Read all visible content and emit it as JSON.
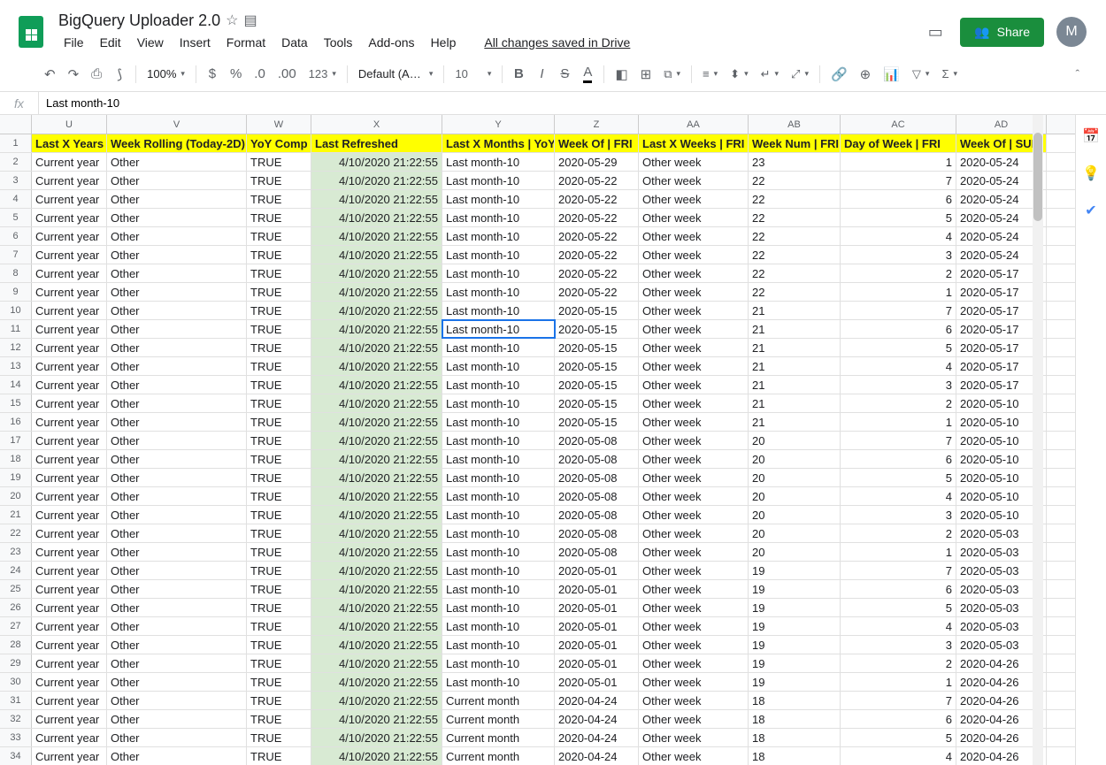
{
  "header": {
    "title": "BigQuery Uploader 2.0",
    "saved_text": "All changes saved in Drive",
    "share_label": "Share",
    "avatar_letter": "M"
  },
  "menubar": [
    "File",
    "Edit",
    "View",
    "Insert",
    "Format",
    "Data",
    "Tools",
    "Add-ons",
    "Help"
  ],
  "toolbar": {
    "zoom": "100%",
    "font": "Default (Ari...",
    "fontsize": "10"
  },
  "formula": {
    "fx": "fx",
    "value": "Last month-10"
  },
  "columns": [
    {
      "letter": "U",
      "label": "Last X Years",
      "cls": "c-u"
    },
    {
      "letter": "V",
      "label": "Week Rolling (Today-2D)",
      "cls": "c-v"
    },
    {
      "letter": "W",
      "label": "YoY Comp",
      "cls": "c-w"
    },
    {
      "letter": "X",
      "label": "Last Refreshed",
      "cls": "c-x"
    },
    {
      "letter": "Y",
      "label": "Last X Months | YoY",
      "cls": "c-y"
    },
    {
      "letter": "Z",
      "label": "Week Of | FRI",
      "cls": "c-z"
    },
    {
      "letter": "AA",
      "label": "Last X Weeks | FRI",
      "cls": "c-aa"
    },
    {
      "letter": "AB",
      "label": "Week Num | FRI",
      "cls": "c-ab"
    },
    {
      "letter": "AC",
      "label": "Day of Week | FRI",
      "cls": "c-ac"
    },
    {
      "letter": "AD",
      "label": "Week Of | SUN",
      "cls": "c-ad"
    }
  ],
  "selected": {
    "row": 11,
    "col": 4
  },
  "rows": [
    {
      "n": 2,
      "u": "Current year",
      "v": "Other",
      "w": "TRUE",
      "x": "4/10/2020 21:22:55",
      "y": "Last month-10",
      "z": "2020-05-29",
      "aa": "Other week",
      "ab": "23",
      "ac": "1",
      "ad": "2020-05-24"
    },
    {
      "n": 3,
      "u": "Current year",
      "v": "Other",
      "w": "TRUE",
      "x": "4/10/2020 21:22:55",
      "y": "Last month-10",
      "z": "2020-05-22",
      "aa": "Other week",
      "ab": "22",
      "ac": "7",
      "ad": "2020-05-24"
    },
    {
      "n": 4,
      "u": "Current year",
      "v": "Other",
      "w": "TRUE",
      "x": "4/10/2020 21:22:55",
      "y": "Last month-10",
      "z": "2020-05-22",
      "aa": "Other week",
      "ab": "22",
      "ac": "6",
      "ad": "2020-05-24"
    },
    {
      "n": 5,
      "u": "Current year",
      "v": "Other",
      "w": "TRUE",
      "x": "4/10/2020 21:22:55",
      "y": "Last month-10",
      "z": "2020-05-22",
      "aa": "Other week",
      "ab": "22",
      "ac": "5",
      "ad": "2020-05-24"
    },
    {
      "n": 6,
      "u": "Current year",
      "v": "Other",
      "w": "TRUE",
      "x": "4/10/2020 21:22:55",
      "y": "Last month-10",
      "z": "2020-05-22",
      "aa": "Other week",
      "ab": "22",
      "ac": "4",
      "ad": "2020-05-24"
    },
    {
      "n": 7,
      "u": "Current year",
      "v": "Other",
      "w": "TRUE",
      "x": "4/10/2020 21:22:55",
      "y": "Last month-10",
      "z": "2020-05-22",
      "aa": "Other week",
      "ab": "22",
      "ac": "3",
      "ad": "2020-05-24"
    },
    {
      "n": 8,
      "u": "Current year",
      "v": "Other",
      "w": "TRUE",
      "x": "4/10/2020 21:22:55",
      "y": "Last month-10",
      "z": "2020-05-22",
      "aa": "Other week",
      "ab": "22",
      "ac": "2",
      "ad": "2020-05-17"
    },
    {
      "n": 9,
      "u": "Current year",
      "v": "Other",
      "w": "TRUE",
      "x": "4/10/2020 21:22:55",
      "y": "Last month-10",
      "z": "2020-05-22",
      "aa": "Other week",
      "ab": "22",
      "ac": "1",
      "ad": "2020-05-17"
    },
    {
      "n": 10,
      "u": "Current year",
      "v": "Other",
      "w": "TRUE",
      "x": "4/10/2020 21:22:55",
      "y": "Last month-10",
      "z": "2020-05-15",
      "aa": "Other week",
      "ab": "21",
      "ac": "7",
      "ad": "2020-05-17"
    },
    {
      "n": 11,
      "u": "Current year",
      "v": "Other",
      "w": "TRUE",
      "x": "4/10/2020 21:22:55",
      "y": "Last month-10",
      "z": "2020-05-15",
      "aa": "Other week",
      "ab": "21",
      "ac": "6",
      "ad": "2020-05-17"
    },
    {
      "n": 12,
      "u": "Current year",
      "v": "Other",
      "w": "TRUE",
      "x": "4/10/2020 21:22:55",
      "y": "Last month-10",
      "z": "2020-05-15",
      "aa": "Other week",
      "ab": "21",
      "ac": "5",
      "ad": "2020-05-17"
    },
    {
      "n": 13,
      "u": "Current year",
      "v": "Other",
      "w": "TRUE",
      "x": "4/10/2020 21:22:55",
      "y": "Last month-10",
      "z": "2020-05-15",
      "aa": "Other week",
      "ab": "21",
      "ac": "4",
      "ad": "2020-05-17"
    },
    {
      "n": 14,
      "u": "Current year",
      "v": "Other",
      "w": "TRUE",
      "x": "4/10/2020 21:22:55",
      "y": "Last month-10",
      "z": "2020-05-15",
      "aa": "Other week",
      "ab": "21",
      "ac": "3",
      "ad": "2020-05-17"
    },
    {
      "n": 15,
      "u": "Current year",
      "v": "Other",
      "w": "TRUE",
      "x": "4/10/2020 21:22:55",
      "y": "Last month-10",
      "z": "2020-05-15",
      "aa": "Other week",
      "ab": "21",
      "ac": "2",
      "ad": "2020-05-10"
    },
    {
      "n": 16,
      "u": "Current year",
      "v": "Other",
      "w": "TRUE",
      "x": "4/10/2020 21:22:55",
      "y": "Last month-10",
      "z": "2020-05-15",
      "aa": "Other week",
      "ab": "21",
      "ac": "1",
      "ad": "2020-05-10"
    },
    {
      "n": 17,
      "u": "Current year",
      "v": "Other",
      "w": "TRUE",
      "x": "4/10/2020 21:22:55",
      "y": "Last month-10",
      "z": "2020-05-08",
      "aa": "Other week",
      "ab": "20",
      "ac": "7",
      "ad": "2020-05-10"
    },
    {
      "n": 18,
      "u": "Current year",
      "v": "Other",
      "w": "TRUE",
      "x": "4/10/2020 21:22:55",
      "y": "Last month-10",
      "z": "2020-05-08",
      "aa": "Other week",
      "ab": "20",
      "ac": "6",
      "ad": "2020-05-10"
    },
    {
      "n": 19,
      "u": "Current year",
      "v": "Other",
      "w": "TRUE",
      "x": "4/10/2020 21:22:55",
      "y": "Last month-10",
      "z": "2020-05-08",
      "aa": "Other week",
      "ab": "20",
      "ac": "5",
      "ad": "2020-05-10"
    },
    {
      "n": 20,
      "u": "Current year",
      "v": "Other",
      "w": "TRUE",
      "x": "4/10/2020 21:22:55",
      "y": "Last month-10",
      "z": "2020-05-08",
      "aa": "Other week",
      "ab": "20",
      "ac": "4",
      "ad": "2020-05-10"
    },
    {
      "n": 21,
      "u": "Current year",
      "v": "Other",
      "w": "TRUE",
      "x": "4/10/2020 21:22:55",
      "y": "Last month-10",
      "z": "2020-05-08",
      "aa": "Other week",
      "ab": "20",
      "ac": "3",
      "ad": "2020-05-10"
    },
    {
      "n": 22,
      "u": "Current year",
      "v": "Other",
      "w": "TRUE",
      "x": "4/10/2020 21:22:55",
      "y": "Last month-10",
      "z": "2020-05-08",
      "aa": "Other week",
      "ab": "20",
      "ac": "2",
      "ad": "2020-05-03"
    },
    {
      "n": 23,
      "u": "Current year",
      "v": "Other",
      "w": "TRUE",
      "x": "4/10/2020 21:22:55",
      "y": "Last month-10",
      "z": "2020-05-08",
      "aa": "Other week",
      "ab": "20",
      "ac": "1",
      "ad": "2020-05-03"
    },
    {
      "n": 24,
      "u": "Current year",
      "v": "Other",
      "w": "TRUE",
      "x": "4/10/2020 21:22:55",
      "y": "Last month-10",
      "z": "2020-05-01",
      "aa": "Other week",
      "ab": "19",
      "ac": "7",
      "ad": "2020-05-03"
    },
    {
      "n": 25,
      "u": "Current year",
      "v": "Other",
      "w": "TRUE",
      "x": "4/10/2020 21:22:55",
      "y": "Last month-10",
      "z": "2020-05-01",
      "aa": "Other week",
      "ab": "19",
      "ac": "6",
      "ad": "2020-05-03"
    },
    {
      "n": 26,
      "u": "Current year",
      "v": "Other",
      "w": "TRUE",
      "x": "4/10/2020 21:22:55",
      "y": "Last month-10",
      "z": "2020-05-01",
      "aa": "Other week",
      "ab": "19",
      "ac": "5",
      "ad": "2020-05-03"
    },
    {
      "n": 27,
      "u": "Current year",
      "v": "Other",
      "w": "TRUE",
      "x": "4/10/2020 21:22:55",
      "y": "Last month-10",
      "z": "2020-05-01",
      "aa": "Other week",
      "ab": "19",
      "ac": "4",
      "ad": "2020-05-03"
    },
    {
      "n": 28,
      "u": "Current year",
      "v": "Other",
      "w": "TRUE",
      "x": "4/10/2020 21:22:55",
      "y": "Last month-10",
      "z": "2020-05-01",
      "aa": "Other week",
      "ab": "19",
      "ac": "3",
      "ad": "2020-05-03"
    },
    {
      "n": 29,
      "u": "Current year",
      "v": "Other",
      "w": "TRUE",
      "x": "4/10/2020 21:22:55",
      "y": "Last month-10",
      "z": "2020-05-01",
      "aa": "Other week",
      "ab": "19",
      "ac": "2",
      "ad": "2020-04-26"
    },
    {
      "n": 30,
      "u": "Current year",
      "v": "Other",
      "w": "TRUE",
      "x": "4/10/2020 21:22:55",
      "y": "Last month-10",
      "z": "2020-05-01",
      "aa": "Other week",
      "ab": "19",
      "ac": "1",
      "ad": "2020-04-26"
    },
    {
      "n": 31,
      "u": "Current year",
      "v": "Other",
      "w": "TRUE",
      "x": "4/10/2020 21:22:55",
      "y": "Current month",
      "z": "2020-04-24",
      "aa": "Other week",
      "ab": "18",
      "ac": "7",
      "ad": "2020-04-26"
    },
    {
      "n": 32,
      "u": "Current year",
      "v": "Other",
      "w": "TRUE",
      "x": "4/10/2020 21:22:55",
      "y": "Current month",
      "z": "2020-04-24",
      "aa": "Other week",
      "ab": "18",
      "ac": "6",
      "ad": "2020-04-26"
    },
    {
      "n": 33,
      "u": "Current year",
      "v": "Other",
      "w": "TRUE",
      "x": "4/10/2020 21:22:55",
      "y": "Current month",
      "z": "2020-04-24",
      "aa": "Other week",
      "ab": "18",
      "ac": "5",
      "ad": "2020-04-26"
    },
    {
      "n": 34,
      "u": "Current year",
      "v": "Other",
      "w": "TRUE",
      "x": "4/10/2020 21:22:55",
      "y": "Current month",
      "z": "2020-04-24",
      "aa": "Other week",
      "ab": "18",
      "ac": "4",
      "ad": "2020-04-26"
    }
  ]
}
